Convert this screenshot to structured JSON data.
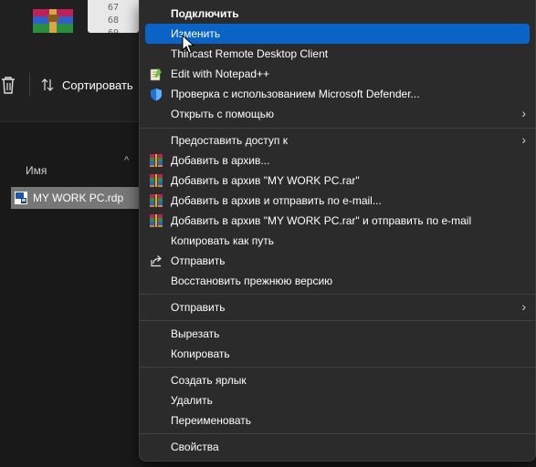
{
  "thumbnail_lines": [
    "67",
    "68",
    "69"
  ],
  "explorer": {
    "sort_label": "Сортировать",
    "column_name": "Имя",
    "file_name": "MY WORK PC.rdp"
  },
  "menu": {
    "connect": "Подключить",
    "edit": "Изменить",
    "thincast": "Thincast Remote Desktop Client",
    "notepad": "Edit with Notepad++",
    "defender": "Проверка с использованием Microsoft Defender...",
    "open_with": "Открыть с помощью",
    "give_access": "Предоставить доступ к",
    "add_archive": "Добавить в архив...",
    "add_rar": "Добавить в архив \"MY WORK PC.rar\"",
    "add_email": "Добавить в архив и отправить по e-mail...",
    "add_rar_email": "Добавить в архив \"MY WORK PC.rar\" и отправить по e-mail",
    "copy_path": "Копировать как путь",
    "share": "Отправить",
    "restore": "Восстановить прежнюю версию",
    "send_to": "Отправить",
    "cut": "Вырезать",
    "copy": "Копировать",
    "create_shortcut": "Создать ярлык",
    "delete": "Удалить",
    "rename": "Переименовать",
    "properties": "Свойства"
  },
  "colors": {
    "highlight": "#0a64c8",
    "menu_bg": "#2b2b2b",
    "file_selected": "#777777"
  },
  "icons": [
    "winrar-icon",
    "notepadpp-icon",
    "defender-shield-icon",
    "share-icon",
    "trash-icon",
    "sort-arrows-icon",
    "rdp-file-icon",
    "chevron-right-icon"
  ]
}
